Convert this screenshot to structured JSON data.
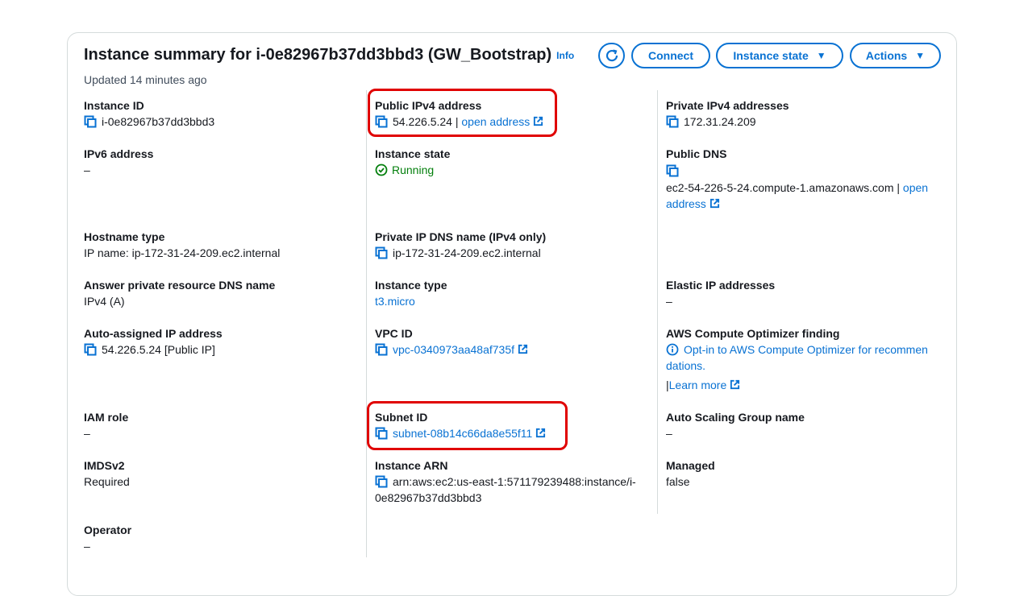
{
  "header": {
    "title": "Instance summary for i-0e82967b37dd3bbd3 (GW_Bootstrap)",
    "info": "Info",
    "updated": "Updated 14 minutes ago",
    "buttons": {
      "connect": "Connect",
      "instance_state": "Instance state",
      "actions": "Actions"
    }
  },
  "colors": {
    "link": "#0972d3",
    "success": "#037f0c",
    "highlight": "#e00000"
  },
  "fields": {
    "instance_id": {
      "label": "Instance ID",
      "value": "i-0e82967b37dd3bbd3"
    },
    "public_ipv4": {
      "label": "Public IPv4 address",
      "value": "54.226.5.24",
      "sep": " | ",
      "link": "open address"
    },
    "private_ipv4": {
      "label": "Private IPv4 addresses",
      "value": "172.31.24.209"
    },
    "ipv6": {
      "label": "IPv6 address",
      "value": "–"
    },
    "instance_state": {
      "label": "Instance state",
      "value": "Running"
    },
    "public_dns": {
      "label": "Public DNS",
      "value": "ec2-54-226-5-24.compute-1.amazonaws.com",
      "sep": " | ",
      "link": "open address"
    },
    "hostname_type": {
      "label": "Hostname type",
      "value": "IP name: ip-172-31-24-209.ec2.internal"
    },
    "private_ip_dns": {
      "label": "Private IP DNS name (IPv4 only)",
      "value": "ip-172-31-24-209.ec2.internal"
    },
    "answer_dns": {
      "label": "Answer private resource DNS name",
      "value": "IPv4 (A)"
    },
    "instance_type": {
      "label": "Instance type",
      "value": "t3.micro"
    },
    "elastic_ip": {
      "label": "Elastic IP addresses",
      "value": "–"
    },
    "auto_assigned_ip": {
      "label": "Auto-assigned IP address",
      "value": "54.226.5.24 [Public IP]"
    },
    "vpc_id": {
      "label": "VPC ID",
      "value": "vpc-0340973aa48af735f"
    },
    "optimizer": {
      "label": "AWS Compute Optimizer finding",
      "line1": "Opt-in to AWS Compute Optimizer for recommen",
      "line2": "dations.",
      "sep": "| ",
      "learn_more": "Learn more"
    },
    "iam_role": {
      "label": "IAM role",
      "value": "–"
    },
    "subnet_id": {
      "label": "Subnet ID",
      "value": "subnet-08b14c66da8e55f11"
    },
    "asg_name": {
      "label": "Auto Scaling Group name",
      "value": "–"
    },
    "imdsv2": {
      "label": "IMDSv2",
      "value": "Required"
    },
    "instance_arn": {
      "label": "Instance ARN",
      "line1": "arn:aws:ec2:us-east-1:571179239488:instance/i-",
      "line2": "0e82967b37dd3bbd3"
    },
    "managed": {
      "label": "Managed",
      "value": "false"
    },
    "operator": {
      "label": "Operator",
      "value": "–"
    }
  }
}
